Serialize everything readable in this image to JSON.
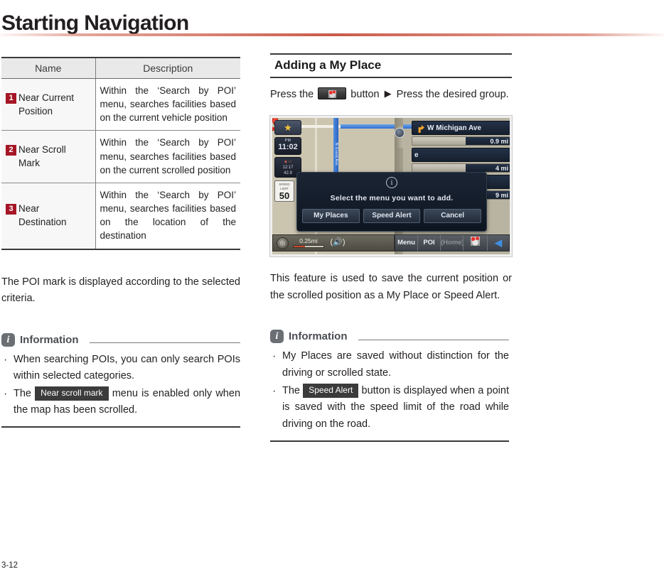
{
  "page": {
    "title": "Starting Navigation",
    "footer": "3-12"
  },
  "left": {
    "table": {
      "headers": [
        "Name",
        "Description"
      ],
      "rows": [
        {
          "badge": "1",
          "name_line1": "Near Current",
          "name_line2": "Position",
          "description": "Within the ‘Search by POI’ menu, searches facilities based on the current vehicle position"
        },
        {
          "badge": "2",
          "name_line1": "Near Scroll",
          "name_line2": "Mark",
          "description": "Within the ‘Search by POI’ menu, searches facilities based on the current scrolled position"
        },
        {
          "badge": "3",
          "name_line1": "Near",
          "name_line2": "Destination",
          "description": "Within the ‘Search by POI’ menu, searches facilities based on the location of the destination"
        }
      ]
    },
    "poi_note": "The POI mark is displayed according to the selected criteria.",
    "information": {
      "title": "Information",
      "bullets": [
        {
          "before": "When searching POIs, you can only search POIs within selected categories.",
          "chip": "",
          "after": ""
        },
        {
          "before": "The ",
          "chip": "Near scroll mark",
          "after": " menu is enabled only when the map has been scrolled."
        }
      ]
    }
  },
  "right": {
    "section_title": "Adding a My Place",
    "press_steps": {
      "before": "Press the ",
      "button_icon": "my-place-button-icon",
      "middle": " button ",
      "arrow": "▶",
      "after": " Press the desired group."
    },
    "feature_note": "This feature is used to save the current position or the scrolled position as a My Place or Speed Alert.",
    "information": {
      "title": "Information",
      "bullets": [
        {
          "before": "My Places are saved without distinction for the driving or scrolled state.",
          "chip": "",
          "after": ""
        },
        {
          "before": "The ",
          "chip": "Speed Alert",
          "after": " button is displayed when a point is saved with the speed limit of the road while driving on the road."
        }
      ]
    },
    "nav_screenshot": {
      "alt": "navigation-map-screenshot",
      "hud": {
        "star_icon": "favorite-star-icon",
        "clock_ampm": "PM",
        "clock_time": "11:02",
        "eco_line1": "12:17",
        "eco_line2": "42.9",
        "speed_label": "SPEED LIMIT",
        "speed_value": "50"
      },
      "road_label": "N Grand Ave",
      "guidance": [
        {
          "type": "street",
          "text": "W Michigan Ave",
          "icon": "turn-right-arrow-icon"
        },
        {
          "type": "distance",
          "text": "0.9 mi"
        },
        {
          "type": "street",
          "text": "e"
        },
        {
          "type": "distance",
          "text": "4 mi"
        },
        {
          "type": "distance",
          "text": "9 mi"
        }
      ],
      "dialog": {
        "icon": "information-circle-icon",
        "message": "Select the menu you want to add.",
        "buttons": [
          "My Places",
          "Speed Alert",
          "Cancel"
        ]
      },
      "toolbar": {
        "compass_icon": "compass-icon",
        "scale": "0.25mi",
        "volume_icon": "speaker-icon",
        "items": [
          "Menu",
          "POI",
          "(Home)"
        ],
        "my_place_icon": "my-place-icon",
        "back_icon": "◀"
      }
    }
  },
  "colors": {
    "accent_rule": "#c75240",
    "badge_red": "#a51626",
    "chip_bg": "#3b3b3b",
    "info_icon": "#6b6e73",
    "table_header_bg": "#e9e9e9"
  }
}
